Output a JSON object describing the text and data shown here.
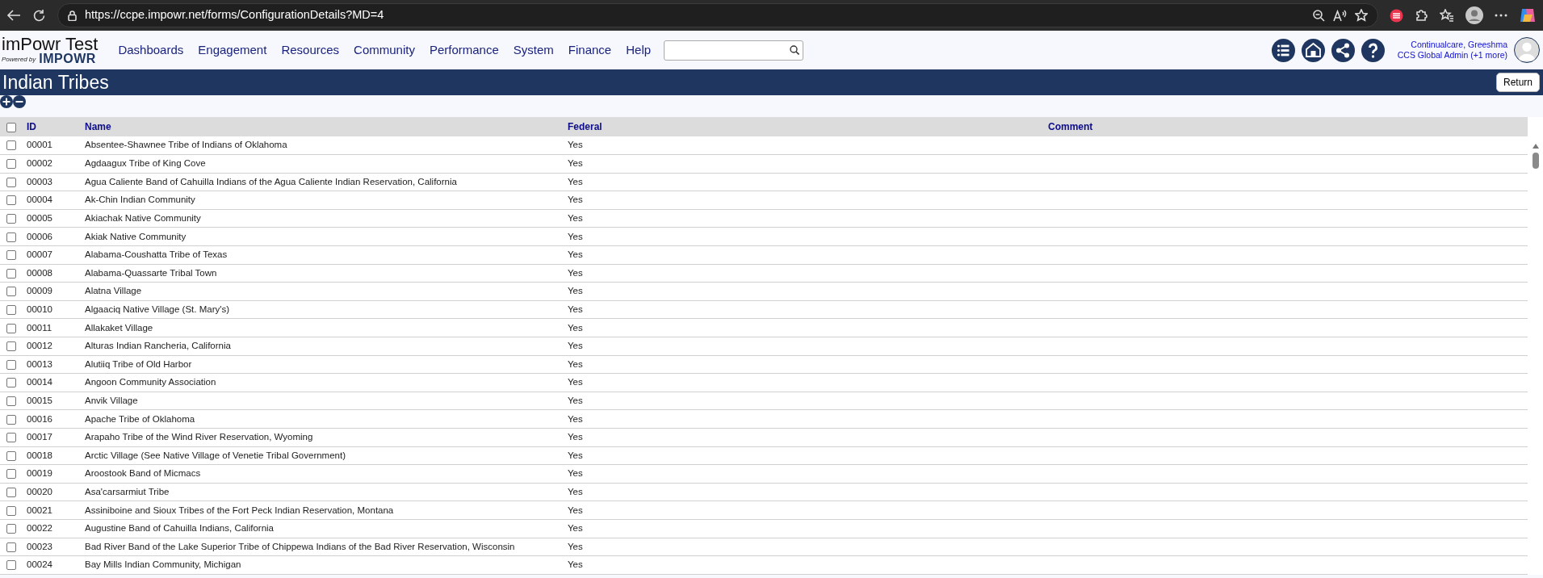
{
  "browser": {
    "url": "https://ccpe.impowr.net/forms/ConfigurationDetails?MD=4"
  },
  "app": {
    "title": "imPowr Test",
    "powered_by": "Powered by",
    "brand": "IMPOWR",
    "menu": [
      "Dashboards",
      "Engagement",
      "Resources",
      "Community",
      "Performance",
      "System",
      "Finance",
      "Help"
    ],
    "user": {
      "name": "Continualcare, Greeshma",
      "role": "CCS Global Admin (+1 more)"
    }
  },
  "page": {
    "title": "Indian Tribes",
    "return_button": "Return"
  },
  "table": {
    "select_all": {
      "checked": false
    },
    "columns": [
      "ID",
      "Name",
      "Federal",
      "Comment"
    ],
    "rows": [
      {
        "checked": false,
        "id": "00001",
        "name": "Absentee-Shawnee Tribe of Indians of Oklahoma",
        "federal": "Yes"
      },
      {
        "checked": false,
        "id": "00002",
        "name": "Agdaagux Tribe of King Cove",
        "federal": "Yes"
      },
      {
        "checked": false,
        "id": "00003",
        "name": "Agua Caliente Band of Cahuilla Indians of the Agua Caliente Indian Reservation, California",
        "federal": "Yes"
      },
      {
        "checked": false,
        "id": "00004",
        "name": "Ak-Chin Indian Community",
        "federal": "Yes"
      },
      {
        "checked": false,
        "id": "00005",
        "name": "Akiachak Native Community",
        "federal": "Yes"
      },
      {
        "checked": false,
        "id": "00006",
        "name": "Akiak Native Community",
        "federal": "Yes"
      },
      {
        "checked": false,
        "id": "00007",
        "name": "Alabama-Coushatta Tribe of Texas",
        "federal": "Yes"
      },
      {
        "checked": false,
        "id": "00008",
        "name": "Alabama-Quassarte Tribal Town",
        "federal": "Yes"
      },
      {
        "checked": false,
        "id": "00009",
        "name": "Alatna Village",
        "federal": "Yes"
      },
      {
        "checked": false,
        "id": "00010",
        "name": "Algaaciq Native Village (St. Mary's)",
        "federal": "Yes"
      },
      {
        "checked": false,
        "id": "00011",
        "name": "Allakaket Village",
        "federal": "Yes"
      },
      {
        "checked": false,
        "id": "00012",
        "name": "Alturas Indian Rancheria, California",
        "federal": "Yes"
      },
      {
        "checked": false,
        "id": "00013",
        "name": "Alutiiq Tribe of Old Harbor",
        "federal": "Yes"
      },
      {
        "checked": false,
        "id": "00014",
        "name": "Angoon Community Association",
        "federal": "Yes"
      },
      {
        "checked": false,
        "id": "00015",
        "name": "Anvik Village",
        "federal": "Yes"
      },
      {
        "checked": false,
        "id": "00016",
        "name": "Apache Tribe of Oklahoma",
        "federal": "Yes"
      },
      {
        "checked": false,
        "id": "00017",
        "name": "Arapaho Tribe of the Wind River Reservation, Wyoming",
        "federal": "Yes"
      },
      {
        "checked": false,
        "id": "00018",
        "name": "Arctic Village (See Native Village of Venetie Tribal Government)",
        "federal": "Yes"
      },
      {
        "checked": false,
        "id": "00019",
        "name": "Aroostook Band of Micmacs",
        "federal": "Yes"
      },
      {
        "checked": false,
        "id": "00020",
        "name": "Asa'carsarmiut Tribe",
        "federal": "Yes"
      },
      {
        "checked": false,
        "id": "00021",
        "name": "Assiniboine and Sioux Tribes of the Fort Peck Indian Reservation, Montana",
        "federal": "Yes"
      },
      {
        "checked": false,
        "id": "00022",
        "name": "Augustine Band of Cahuilla Indians, California",
        "federal": "Yes"
      },
      {
        "checked": false,
        "id": "00023",
        "name": "Bad River Band of the Lake Superior Tribe of Chippewa Indians of the Bad River Reservation, Wisconsin",
        "federal": "Yes"
      },
      {
        "checked": false,
        "id": "00024",
        "name": "Bay Mills Indian Community, Michigan",
        "federal": "Yes"
      }
    ]
  }
}
